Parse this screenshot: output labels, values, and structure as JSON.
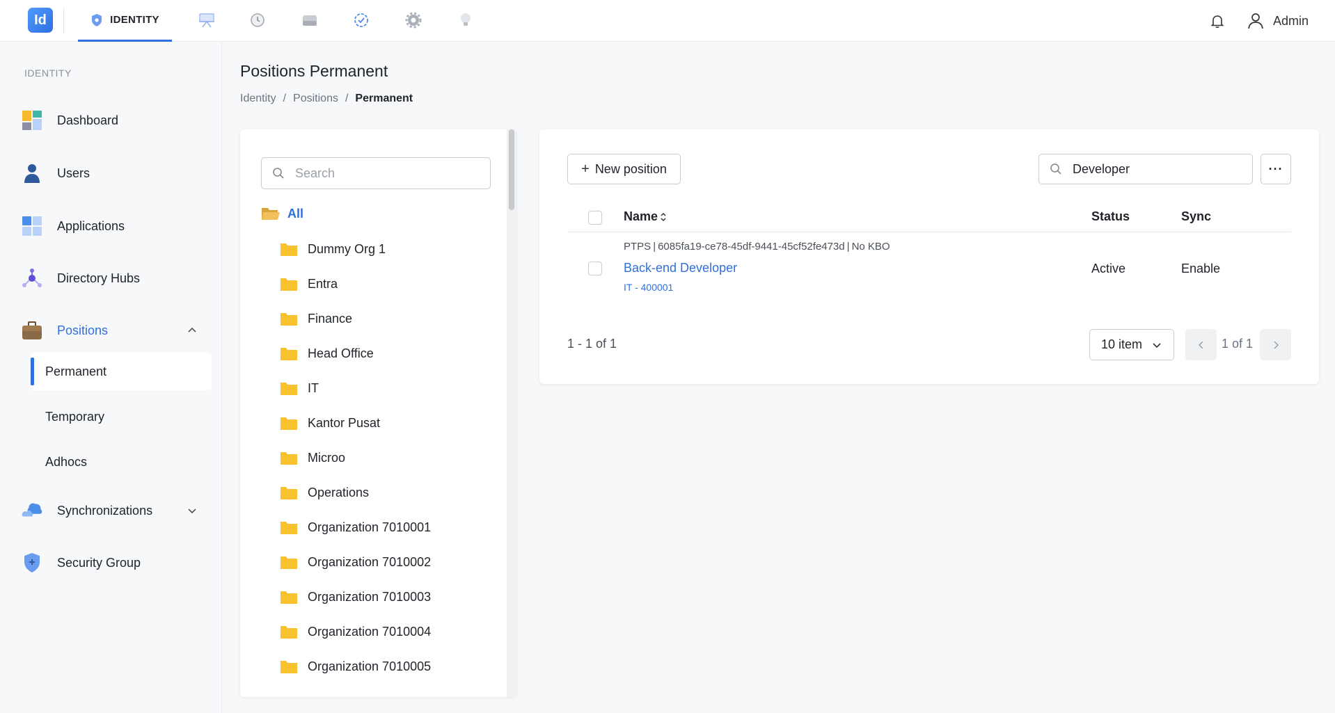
{
  "app": {
    "logo_text": "Id",
    "active_module": "IDENTITY",
    "user_name": "Admin",
    "top_icons": [
      "identity-shield-icon",
      "presentation-icon",
      "history-icon",
      "storage-icon",
      "verified-icon",
      "settings-icon",
      "lightbulb-icon"
    ]
  },
  "sidebar": {
    "section_label": "IDENTITY",
    "items": [
      {
        "label": "Dashboard",
        "icon": "dashboard-icon"
      },
      {
        "label": "Users",
        "icon": "user-icon"
      },
      {
        "label": "Applications",
        "icon": "applications-icon"
      },
      {
        "label": "Directory Hubs",
        "icon": "directory-hub-icon"
      },
      {
        "label": "Positions",
        "icon": "briefcase-icon",
        "expanded": true,
        "active": true
      },
      {
        "label": "Synchronizations",
        "icon": "cloud-sync-icon",
        "expanded": false
      },
      {
        "label": "Security Group",
        "icon": "shield-icon"
      }
    ],
    "positions_sub": [
      {
        "label": "Permanent",
        "active": true
      },
      {
        "label": "Temporary"
      },
      {
        "label": "Adhocs"
      }
    ]
  },
  "page": {
    "title": "Positions Permanent",
    "breadcrumb": [
      "Identity",
      "Positions",
      "Permanent"
    ],
    "breadcrumb_sep": "/"
  },
  "tree": {
    "search_placeholder": "Search",
    "root_label": "All",
    "nodes": [
      "Dummy Org 1",
      "Entra",
      "Finance",
      "Head Office",
      "IT",
      "Kantor Pusat",
      "Microo",
      "Operations",
      "Organization 7010001",
      "Organization 7010002",
      "Organization 7010003",
      "Organization 7010004",
      "Organization 7010005"
    ]
  },
  "table": {
    "new_button_label": "New position",
    "search_value": "Developer",
    "more_label": "···",
    "columns": {
      "name": "Name",
      "status": "Status",
      "sync": "Sync"
    },
    "rows": [
      {
        "type": "PTPS",
        "id": "6085fa19-ce78-45df-9441-45cf52fe473d",
        "kbo": "No KBO",
        "name": "Back-end Developer",
        "code": "IT - 400001",
        "status": "Active",
        "sync": "Enable"
      }
    ],
    "range_text": "1 - 1 of 1",
    "page_size": "10 item",
    "page_text": "1 of 1"
  },
  "colors": {
    "accent": "#2f6fe0",
    "folder": "#f8c22f"
  }
}
